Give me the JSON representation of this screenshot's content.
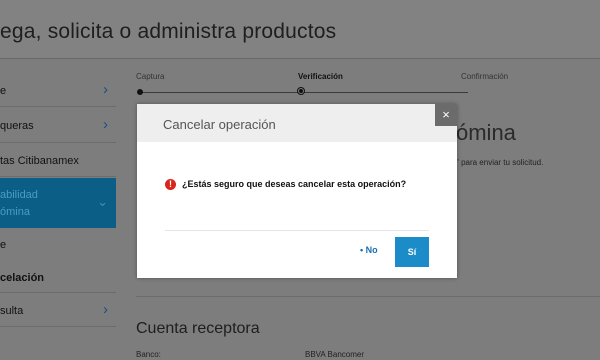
{
  "header": {
    "title": "ega, solicita o administra productos"
  },
  "sidebar": {
    "items": [
      {
        "label": "e",
        "chevron": "›"
      },
      {
        "label": "queras",
        "chevron": "›"
      },
      {
        "label": "tas Citibanamex"
      },
      {
        "label_line1": "abilidad",
        "label_line2": "ómina",
        "chevron": "⌄"
      },
      {
        "label": "e"
      },
      {
        "label": "celación"
      },
      {
        "label": "sulta",
        "chevron": "›"
      }
    ]
  },
  "steps": {
    "items": [
      {
        "label": "Captura"
      },
      {
        "label": "Verificación"
      },
      {
        "label": "Confirmación"
      }
    ],
    "current": "Verificación"
  },
  "background": {
    "heading_partial": "ómina",
    "note_partial": "\" para enviar tu solicitud.",
    "receptor_title": "Cuenta receptora",
    "bank_label": "Banco:",
    "bank_value": "BBVA Bancomer"
  },
  "modal": {
    "title": "Cancelar operación",
    "close_label": "×",
    "warn_glyph": "!",
    "question": "¿Estás seguro que deseas cancelar esta operación?",
    "no_label": "• No",
    "yes_label": "Sí"
  },
  "colors": {
    "overlay": "#7d7d7d",
    "active_sidebar": "#0b5f87",
    "primary_button": "#1b8cc8",
    "link": "#1c6fb0",
    "warning": "#d9261c"
  }
}
